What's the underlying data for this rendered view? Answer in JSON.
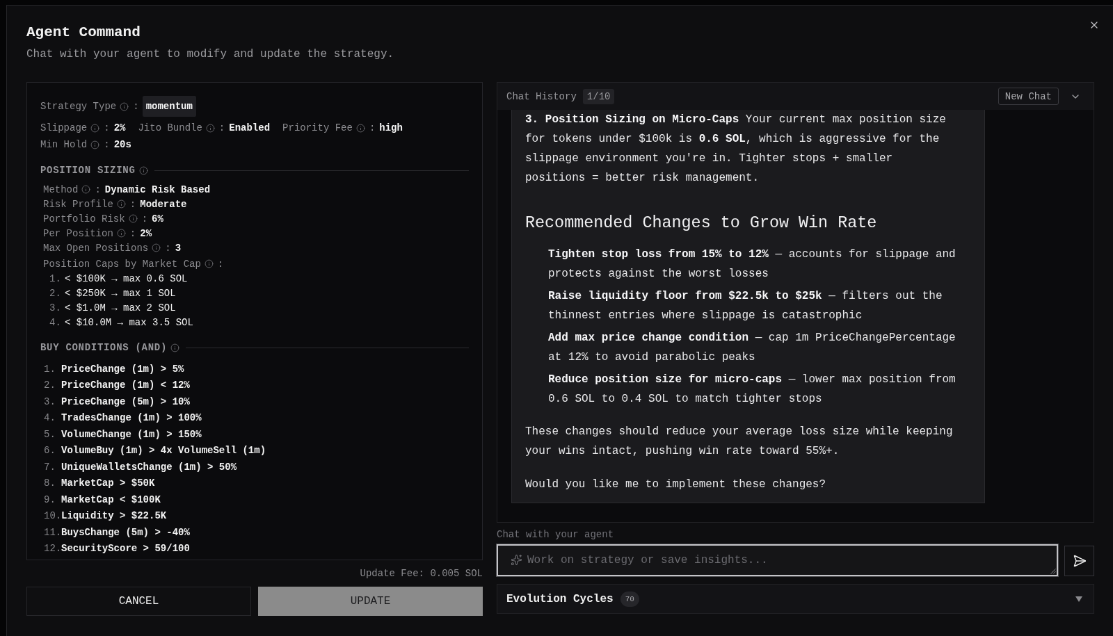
{
  "dialog": {
    "title": "Agent Command",
    "subtitle": "Chat with your agent to modify and update the strategy."
  },
  "strategy": {
    "strategy_type": {
      "label": "Strategy Type",
      "separator": ":",
      "value": "momentum"
    },
    "param_rows": [
      {
        "params": [
          {
            "label": "Slippage",
            "separator": ":",
            "value": "2%"
          },
          {
            "label": "Jito Bundle",
            "separator": ":",
            "value": "Enabled"
          },
          {
            "label": "Priority Fee",
            "separator": ":",
            "value": "high"
          }
        ]
      },
      {
        "params": [
          {
            "label": "Min Hold",
            "separator": ":",
            "value": "20s"
          }
        ]
      }
    ],
    "position_sizing": {
      "heading": "POSITION SIZING",
      "params": [
        {
          "label": "Method",
          "separator": ":",
          "value": "Dynamic Risk Based"
        },
        {
          "label": "Risk Profile",
          "separator": ":",
          "value": "Moderate"
        },
        {
          "label": "Portfolio Risk",
          "separator": ":",
          "value": "6%"
        },
        {
          "label": "Per Position",
          "separator": ":",
          "value": "2%"
        },
        {
          "label": "Max Open Positions",
          "separator": ":",
          "value": "3"
        }
      ],
      "caps": {
        "label": "Position Caps by Market Cap",
        "separator": ":",
        "items": [
          {
            "number": "1.",
            "text": "< $100K → max 0.6 SOL"
          },
          {
            "number": "2.",
            "text": "< $250K → max 1 SOL"
          },
          {
            "number": "3.",
            "text": "< $1.0M → max 2 SOL"
          },
          {
            "number": "4.",
            "text": "< $10.0M → max 3.5 SOL"
          }
        ]
      }
    },
    "buy_conditions": {
      "heading": "BUY CONDITIONS (AND)",
      "items": [
        {
          "number": "1.",
          "text": "PriceChange (1m) > 5%"
        },
        {
          "number": "2.",
          "text": "PriceChange (1m) < 12%"
        },
        {
          "number": "3.",
          "text": "PriceChange (5m) > 10%"
        },
        {
          "number": "4.",
          "text": "TradesChange (1m) > 100%"
        },
        {
          "number": "5.",
          "text": "VolumeChange (1m) > 150%"
        },
        {
          "number": "6.",
          "text": "VolumeBuy (1m) > 4x VolumeSell (1m)"
        },
        {
          "number": "7.",
          "text": "UniqueWalletsChange (1m) > 50%"
        },
        {
          "number": "8.",
          "text": "MarketCap > $50K"
        },
        {
          "number": "9.",
          "text": "MarketCap < $100K"
        },
        {
          "number": "10.",
          "text": "Liquidity > $22.5K"
        },
        {
          "number": "11.",
          "text": "BuysChange (5m) > -40%"
        },
        {
          "number": "12.",
          "text": "SecurityScore > 59/100"
        }
      ]
    }
  },
  "update_fee": "Update Fee: 0.005 SOL",
  "buttons": [
    {
      "label": "CANCEL",
      "kind": "secondary"
    },
    {
      "label": "UPDATE",
      "kind": "primary"
    }
  ],
  "chat_history": {
    "title": "Chat History",
    "counter": "1/10",
    "new_chat": "New Chat",
    "message": {
      "blocks": [
        {
          "kind": "paragraph",
          "text": "**3. Position Sizing on Micro-Caps** Your current max position size for tokens under $100k is **0.6 SOL**, which is aggressive for the slippage environment you're in. Tighter stops + smaller positions = better risk management."
        },
        {
          "kind": "heading",
          "text": "Recommended Changes to Grow Win Rate"
        },
        {
          "kind": "list",
          "items": [
            "**Tighten stop loss from 15% to 12%** — accounts for slippage and protects against the worst losses",
            "**Raise liquidity floor from $22.5k to $25k** — filters out the thinnest entries where slippage is catastrophic",
            "**Add max price change condition** — cap 1m PriceChangePercentage at 12% to avoid parabolic peaks",
            "**Reduce position size for micro-caps** — lower max position from 0.6 SOL to 0.4 SOL to match tighter stops"
          ]
        },
        {
          "kind": "paragraph",
          "text": "These changes should reduce your average loss size while keeping your wins intact, pushing win rate toward 55%+."
        },
        {
          "kind": "paragraph",
          "text": "Would you like me to implement these changes?"
        }
      ]
    }
  },
  "chat_input": {
    "label": "Chat with your agent",
    "placeholder": "Work on strategy or save insights..."
  },
  "evolution_cycles": {
    "title": "Evolution Cycles",
    "count": "70"
  }
}
